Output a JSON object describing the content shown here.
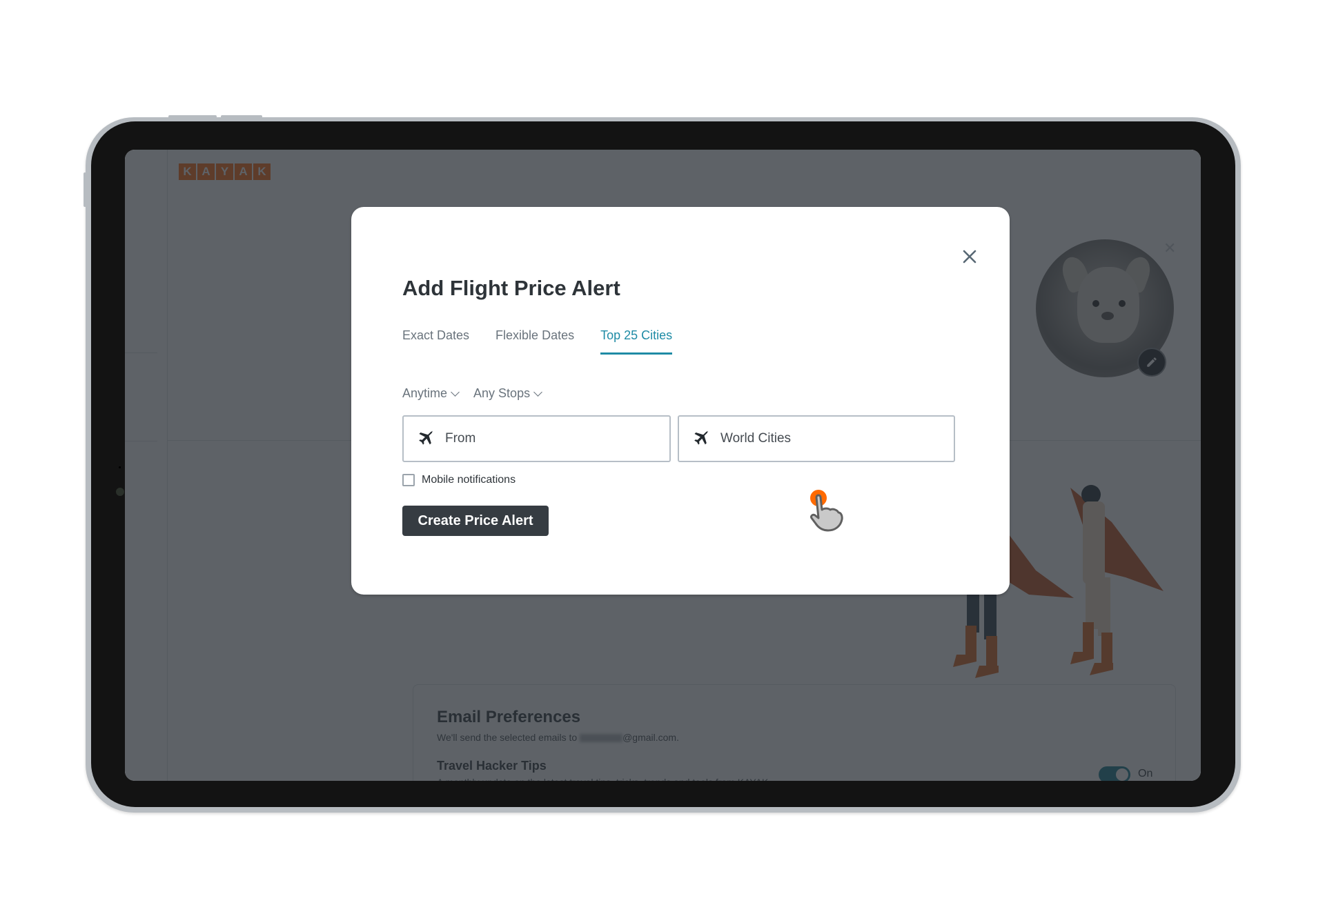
{
  "page": {
    "logo_letters": [
      "K",
      "A",
      "Y",
      "A",
      "K"
    ],
    "email_preferences": {
      "title": "Email Preferences",
      "subtitle_prefix": "We'll send the selected emails to ",
      "subtitle_suffix": "@gmail.com.",
      "item_title": "Travel Hacker Tips",
      "item_description": "A monthly update on the latest travel tips, tricks, trends and tools from KAYAK.",
      "toggle_state": "On"
    }
  },
  "modal": {
    "title": "Add Flight Price Alert",
    "tabs": [
      {
        "label": "Exact Dates",
        "active": false
      },
      {
        "label": "Flexible Dates",
        "active": false
      },
      {
        "label": "Top 25 Cities",
        "active": true
      }
    ],
    "filters": {
      "time": "Anytime",
      "stops": "Any Stops"
    },
    "from_field": {
      "placeholder": "From",
      "icon": "airplane-icon"
    },
    "to_field": {
      "value": "World Cities",
      "icon": "airplane-icon"
    },
    "mobile_notifications": {
      "label": "Mobile notifications",
      "checked": false
    },
    "submit_label": "Create Price Alert",
    "close_icon": "close-icon"
  },
  "colors": {
    "accent": "#1e8ba5",
    "brand": "#ff690f",
    "button": "#363c42",
    "toggle_on": "#137a8a",
    "cursor_tap": "#ff6a00"
  }
}
